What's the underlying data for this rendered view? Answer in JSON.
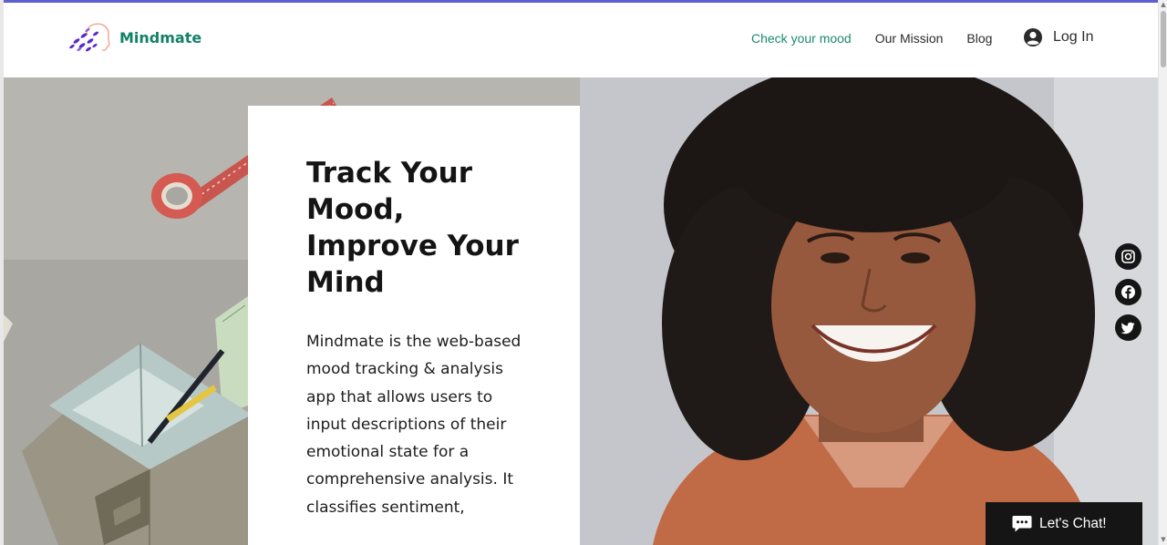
{
  "header": {
    "brand": "Mindmate",
    "nav": [
      {
        "label": "Check your mood",
        "active": true
      },
      {
        "label": "Our Mission",
        "active": false
      },
      {
        "label": "Blog",
        "active": false
      }
    ],
    "login_label": "Log In",
    "brand_color": "#138168",
    "active_nav_color": "#1d8a6f"
  },
  "hero": {
    "headline": "Track Your Mood, Improve Your Mind",
    "description": "Mindmate is the web-based mood tracking & analysis app that allows users to input descriptions of their emotional state for a comprehensive analysis. It classifies sentiment,"
  },
  "social": [
    "instagram-icon",
    "facebook-icon",
    "twitter-icon"
  ],
  "chat": {
    "label": "Let's Chat!"
  },
  "colors": {
    "accent_top_bar": "#5f5fd4",
    "dark": "#151515"
  }
}
